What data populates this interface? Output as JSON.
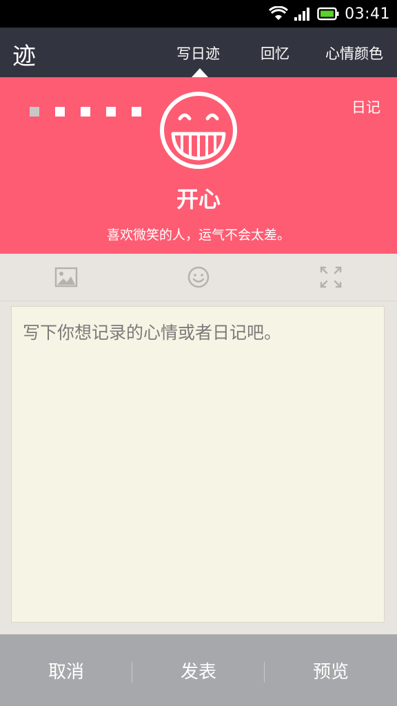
{
  "status_bar": {
    "time": "03:41",
    "icons": [
      "wifi-icon",
      "signal-icon",
      "battery-icon"
    ],
    "battery_color": "#5ad12a"
  },
  "app_bar": {
    "logo": "迹",
    "tabs": [
      {
        "label": "写日迹",
        "active": true
      },
      {
        "label": "回忆",
        "active": false
      },
      {
        "label": "心情颜色",
        "active": false
      }
    ],
    "background": "#323440"
  },
  "mood": {
    "background": "#fe5c73",
    "page_indicator": {
      "count": 5,
      "active_index": 0
    },
    "type_label": "日记",
    "face_icon": "grin-face-icon",
    "title": "开心",
    "quote": "喜欢微笑的人，运气不会太差。"
  },
  "toolbar": {
    "items": [
      "image-icon",
      "emoji-icon",
      "fullscreen-icon"
    ]
  },
  "editor": {
    "value": "",
    "placeholder": "写下你想记录的心情或者日记吧。"
  },
  "bottom_bar": {
    "cancel_label": "取消",
    "publish_label": "发表",
    "preview_label": "预览"
  }
}
